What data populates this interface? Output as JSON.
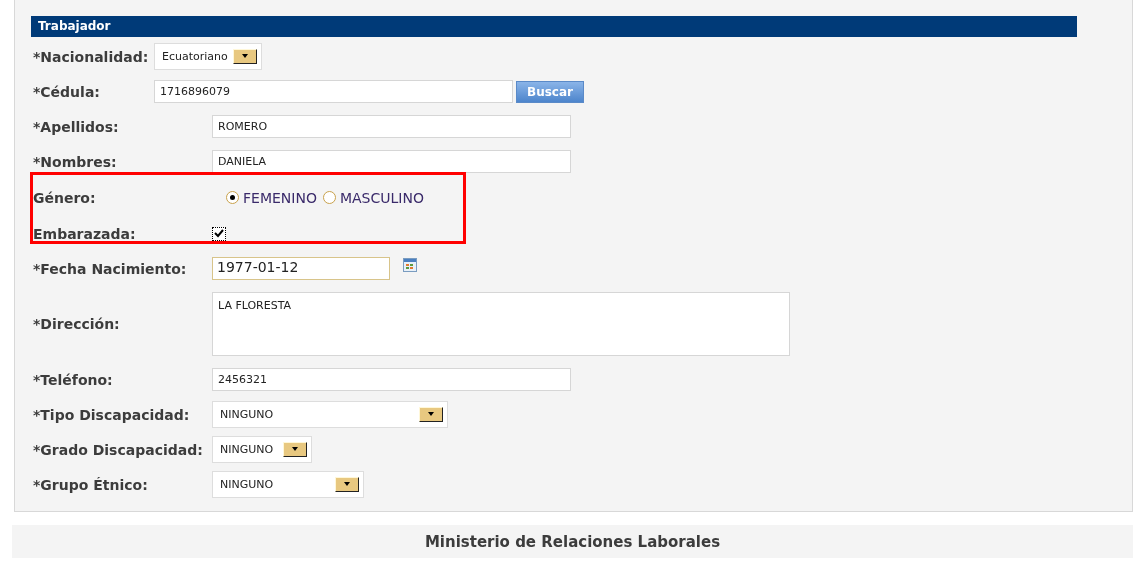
{
  "section": {
    "title": "Trabajador"
  },
  "fields": [
    {
      "kind": "select",
      "label": "*Nacionalidad:",
      "value": "Ecuatoriano"
    },
    {
      "kind": "search",
      "label": "*Cédula:",
      "value": "1716896079",
      "button": "Buscar"
    },
    {
      "kind": "text",
      "label": "*Apellidos:",
      "value": "ROMERO"
    },
    {
      "kind": "text",
      "label": "*Nombres:",
      "value": "DANIELA"
    },
    {
      "kind": "radio",
      "label": "Género:",
      "options": [
        {
          "label": "FEMENINO",
          "selected": true
        },
        {
          "label": "MASCULINO",
          "selected": false
        }
      ]
    },
    {
      "kind": "checkbox",
      "label": "Embarazada:",
      "checked": true
    },
    {
      "kind": "date",
      "label": "*Fecha Nacimiento:",
      "value": "1977-01-12"
    },
    {
      "kind": "textarea",
      "label": "*Dirección:",
      "value": "LA FLORESTA"
    },
    {
      "kind": "text",
      "label": "*Teléfono:",
      "value": "2456321"
    },
    {
      "kind": "select",
      "label": "*Tipo Discapacidad:",
      "value": "NINGUNO"
    },
    {
      "kind": "select",
      "label": "*Grado Discapacidad:",
      "value": "NINGUNO"
    },
    {
      "kind": "select",
      "label": "*Grupo Étnico:",
      "value": "NINGUNO"
    }
  ],
  "footer": "Ministerio de Relaciones Laborales"
}
